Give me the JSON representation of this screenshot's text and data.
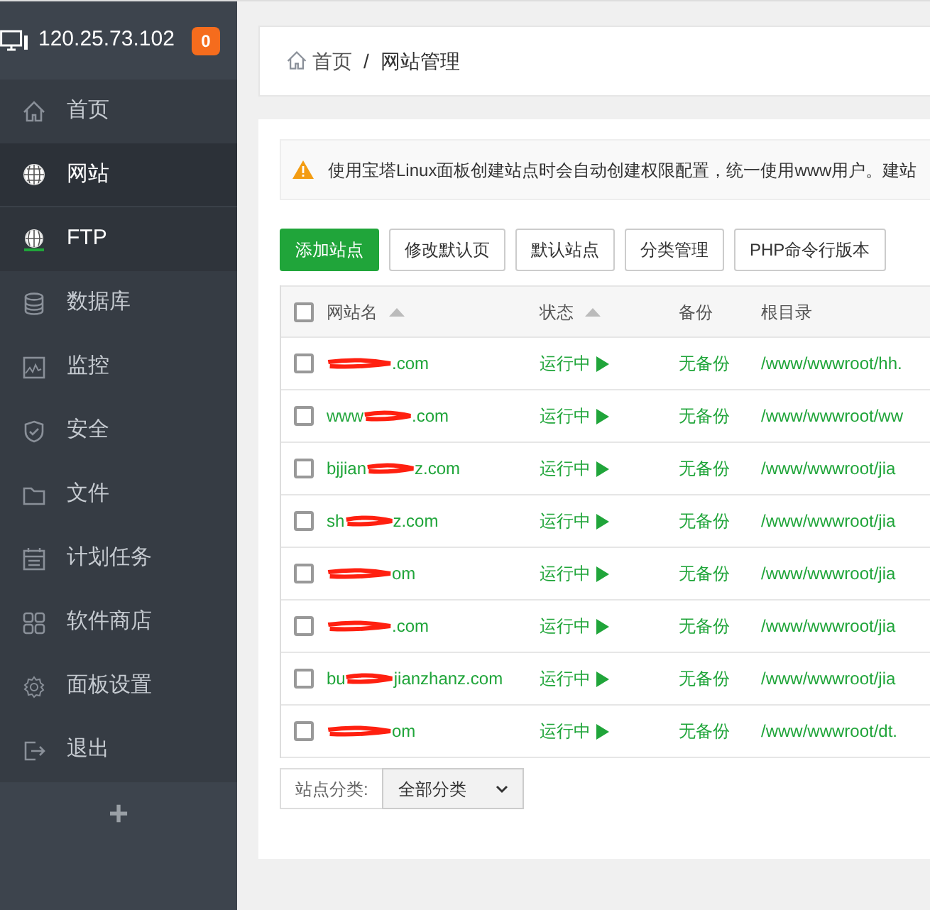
{
  "sidebar": {
    "server_ip": "120.25.73.102",
    "badge": "0",
    "items": [
      {
        "label": "首页",
        "selected": false,
        "hover": false
      },
      {
        "label": "网站",
        "selected": true,
        "hover": false
      },
      {
        "label": "FTP",
        "selected": false,
        "hover": true
      },
      {
        "label": "数据库",
        "selected": false,
        "hover": false
      },
      {
        "label": "监控",
        "selected": false,
        "hover": false
      },
      {
        "label": "安全",
        "selected": false,
        "hover": false
      },
      {
        "label": "文件",
        "selected": false,
        "hover": false
      },
      {
        "label": "计划任务",
        "selected": false,
        "hover": false
      },
      {
        "label": "软件商店",
        "selected": false,
        "hover": false
      },
      {
        "label": "面板设置",
        "selected": false,
        "hover": false
      },
      {
        "label": "退出",
        "selected": false,
        "hover": false
      }
    ],
    "add_button": "+"
  },
  "breadcrumb": [
    "首页",
    "/",
    "网站管理"
  ],
  "notice": "使用宝塔Linux面板创建站点时会自动创建权限配置，统一使用www用户。建站",
  "toolbar": [
    {
      "label": "添加站点",
      "primary": true
    },
    {
      "label": "修改默认页",
      "primary": false
    },
    {
      "label": "默认站点",
      "primary": false
    },
    {
      "label": "分类管理",
      "primary": false
    },
    {
      "label": "PHP命令行版本",
      "primary": false
    }
  ],
  "table": {
    "select_all": {
      "checked": false
    },
    "columns": [
      {
        "label": "网站名",
        "sortable": true
      },
      {
        "label": "状态",
        "sortable": true
      },
      {
        "label": "备份",
        "sortable": false
      },
      {
        "label": "根目录",
        "sortable": false
      }
    ],
    "rows": [
      {
        "checked": false,
        "name_start": "",
        "name_end": ".com",
        "status": "运行中",
        "backup": "无备份",
        "root": "/www/wwwroot/hh."
      },
      {
        "checked": false,
        "name_start": "www",
        "name_end": ".com",
        "status": "运行中",
        "backup": "无备份",
        "root": "/www/wwwroot/ww"
      },
      {
        "checked": false,
        "name_start": "bjjian",
        "name_end": "z.com",
        "status": "运行中",
        "backup": "无备份",
        "root": "/www/wwwroot/jia"
      },
      {
        "checked": false,
        "name_start": "sh",
        "name_end": "z.com",
        "status": "运行中",
        "backup": "无备份",
        "root": "/www/wwwroot/jia"
      },
      {
        "checked": false,
        "name_start": "",
        "name_end": "om",
        "status": "运行中",
        "backup": "无备份",
        "root": "/www/wwwroot/jia"
      },
      {
        "checked": false,
        "name_start": "",
        "name_end": ".com",
        "status": "运行中",
        "backup": "无备份",
        "root": "/www/wwwroot/jia"
      },
      {
        "checked": false,
        "name_start": "bu",
        "name_end": "jianzhanz.com",
        "status": "运行中",
        "backup": "无备份",
        "root": "/www/wwwroot/jia"
      },
      {
        "checked": false,
        "name_start": "",
        "name_end": "om",
        "status": "运行中",
        "backup": "无备份",
        "root": "/www/wwwroot/dt."
      }
    ]
  },
  "category_filter": {
    "label": "站点分类:",
    "value": "全部分类"
  }
}
